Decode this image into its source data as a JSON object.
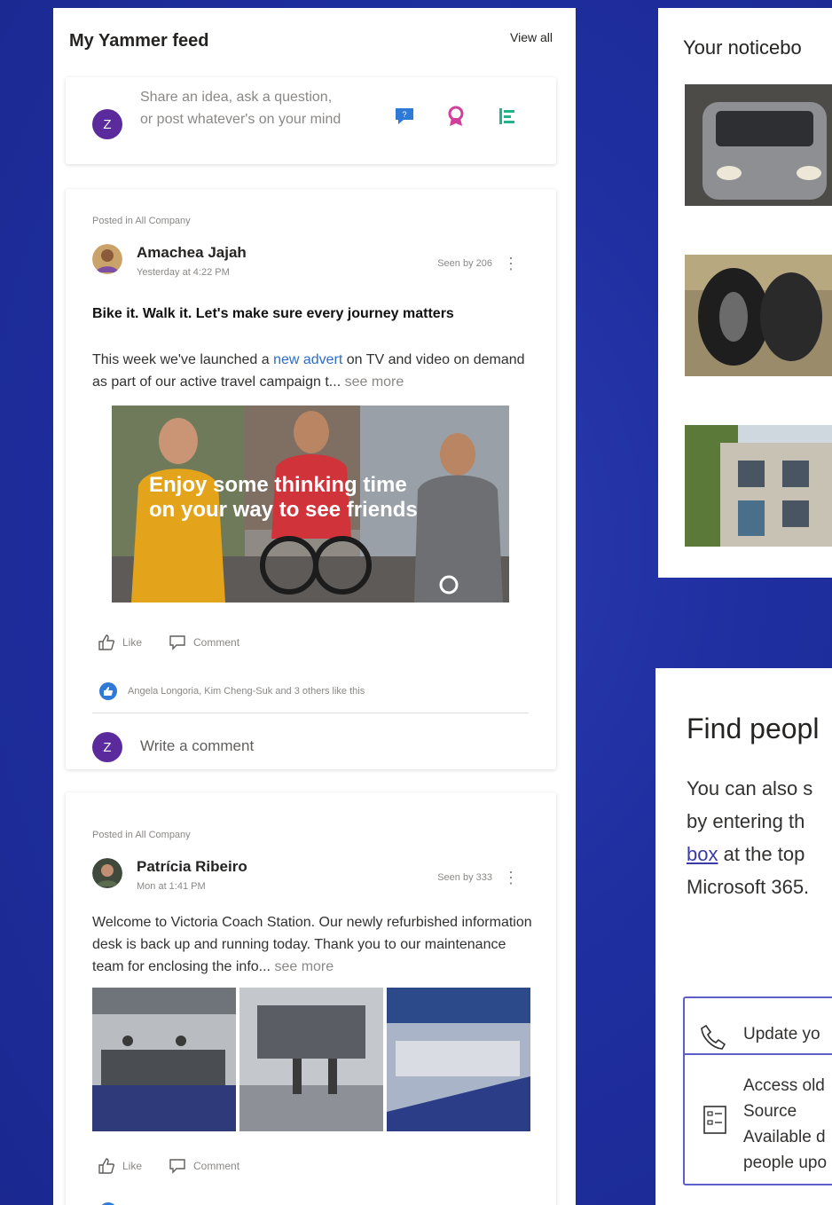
{
  "yammer": {
    "title": "My Yammer feed",
    "view_all": "View all",
    "composer": {
      "avatar_initial": "Z",
      "placeholder": "Share an idea, ask a question, or post whatever's on your mind"
    },
    "posts": [
      {
        "posted_in": "Posted in All Company",
        "author": "Amachea Jajah",
        "time": "Yesterday at 4:22 PM",
        "seen": "Seen by 206",
        "headline": "Bike it. Walk it. Let's make sure every journey matters",
        "body_pre": "This week we've launched a ",
        "body_link": "new advert",
        "body_post": " on TV and video on demand as part of our active travel campaign t... ",
        "see_more": "see more",
        "image_caption_line1": "Enjoy some thinking time",
        "image_caption_line2": "on your way to see friends",
        "like_label": "Like",
        "comment_label": "Comment",
        "likes_text": "Angela Longoria, Kim Cheng-Suk and 3 others like this",
        "comment_avatar_initial": "Z",
        "write_comment": "Write a comment"
      },
      {
        "posted_in": "Posted in All Company",
        "author": "Patrícia Ribeiro",
        "time": "Mon at 1:41 PM",
        "seen": "Seen by 333",
        "body": "Welcome to Victoria Coach Station. Our newly refurbished information desk is back up and running today. Thank you to our maintenance team for enclosing the info... ",
        "see_more": "see more",
        "like_label": "Like",
        "comment_label": "Comment"
      }
    ]
  },
  "noticeboard": {
    "title": "Your noticebo"
  },
  "find_people": {
    "title": "Find peopl",
    "body_line1": "You can also s",
    "body_line2": "by entering th",
    "body_link": "box",
    "body_line3_rest": " at the top",
    "body_line4": "Microsoft 365.",
    "button1_label": "Update yo",
    "button2_line1": "Access old",
    "button2_line2": "Source",
    "button2_line3": "Available d",
    "button2_line4": "people upo"
  },
  "colors": {
    "background": "#1f2fa0",
    "accent_purple": "#5b2a9c",
    "link_blue": "#2e6cc7",
    "button_border": "#5b5fc7"
  }
}
